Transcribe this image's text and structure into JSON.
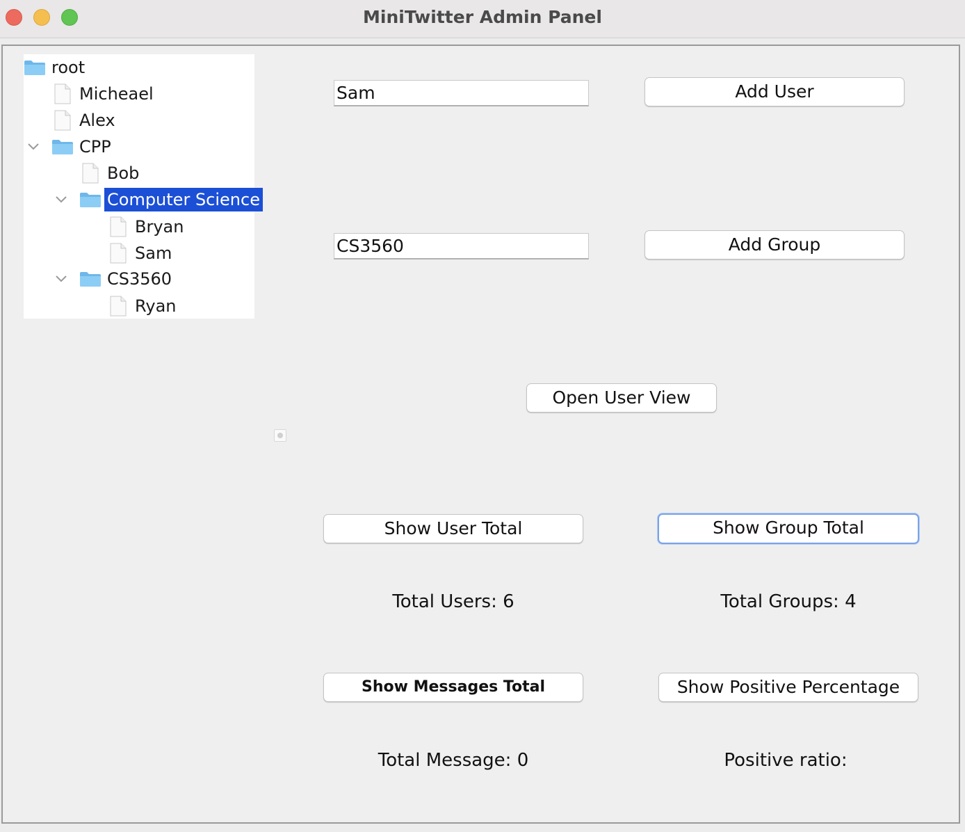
{
  "window": {
    "title": "MiniTwitter Admin Panel"
  },
  "tree": {
    "nodes": [
      {
        "label": "root",
        "type": "folder"
      },
      {
        "label": "Micheael",
        "type": "file"
      },
      {
        "label": "Alex",
        "type": "file"
      },
      {
        "label": "CPP",
        "type": "folder"
      },
      {
        "label": "Bob",
        "type": "file"
      },
      {
        "label": "Computer Science",
        "type": "folder",
        "selected": true
      },
      {
        "label": "Bryan",
        "type": "file"
      },
      {
        "label": "Sam",
        "type": "file"
      },
      {
        "label": "CS3560",
        "type": "folder"
      },
      {
        "label": "Ryan",
        "type": "file"
      }
    ]
  },
  "form": {
    "user_input_value": "Sam",
    "group_input_value": "CS3560",
    "add_user_label": "Add User",
    "add_group_label": "Add Group",
    "open_user_view_label": "Open User View"
  },
  "stats": {
    "show_user_total_label": "Show User Total",
    "show_group_total_label": "Show Group Total",
    "show_messages_total_label": "Show Messages Total",
    "show_positive_percentage_label": "Show Positive Percentage",
    "total_users_text": "Total Users: 6",
    "total_groups_text": "Total Groups: 4",
    "total_message_text": "Total Message: 0",
    "positive_ratio_text": "Positive ratio:"
  },
  "colors": {
    "selection": "#1b4fd6",
    "folder": "#7fc2f0",
    "focus_ring": "#7aa3e6"
  }
}
